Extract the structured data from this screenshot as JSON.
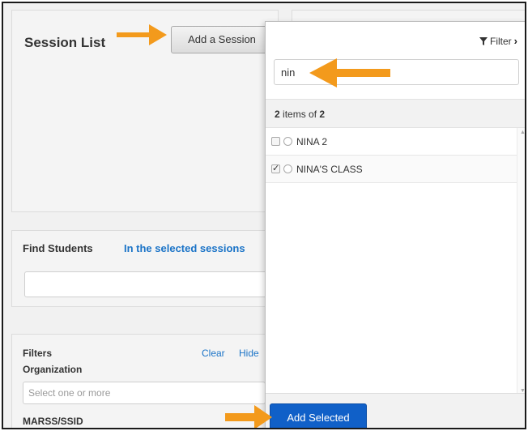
{
  "session_list": {
    "title": "Session List",
    "add_button_label": "Add a Session"
  },
  "find_students": {
    "label": "Find Students",
    "scope_link": "In the selected sessions"
  },
  "filters": {
    "label": "Filters",
    "clear_label": "Clear",
    "hide_label": "Hide",
    "organization_label": "Organization",
    "organization_placeholder": "Select one or more",
    "marss_label": "MARSS/SSID"
  },
  "dropdown": {
    "filter_label": "Filter",
    "search_value": "nin",
    "count_shown": "2",
    "count_text": "items of",
    "count_total": "2",
    "items": [
      {
        "label": "NINA 2",
        "checked": false
      },
      {
        "label": "NINA'S CLASS",
        "checked": true
      }
    ],
    "add_selected_label": "Add Selected"
  },
  "colors": {
    "arrow": "#f39a1c",
    "primary_button": "#1060c8",
    "link": "#1a73c7"
  },
  "icons": {
    "filter": "funnel-icon",
    "chevron": "chevron-right-icon",
    "arrow": "orange-annotation-arrow"
  }
}
